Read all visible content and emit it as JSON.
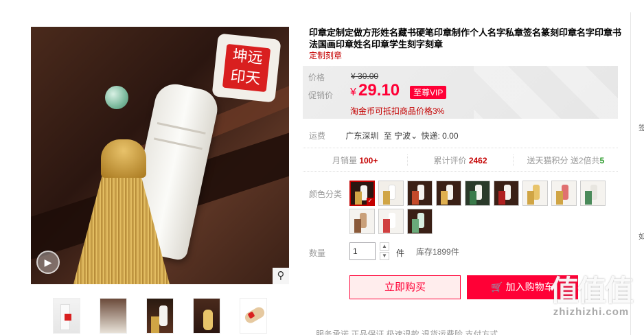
{
  "product": {
    "title": "印章定制定做方形姓名藏书硬笔印章制作个人名字私章签名篆刻印章名字印章书法国画印章姓名印章学生刻字刻章",
    "subtitle": "定制刻章"
  },
  "gallery": {
    "seal_text": "坤远印天",
    "thumbnails": [
      "thumb-1",
      "thumb-2",
      "thumb-3",
      "thumb-4",
      "thumb-5"
    ]
  },
  "price": {
    "orig_label": "价格",
    "orig_currency": "¥",
    "orig_value": "30.00",
    "sale_label": "促销价",
    "sale_currency": "¥",
    "sale_value": "29.10",
    "vip_badge": "至尊VIP",
    "coin_note": "淘金币可抵扣商品价格3%"
  },
  "shipping": {
    "label": "运费",
    "from": "广东深圳",
    "to_word": "至",
    "to": "宁波",
    "express": "快递: 0.00"
  },
  "stats": {
    "monthly_label": "月销量",
    "monthly_value": "100+",
    "reviews_label": "累计评价",
    "reviews_value": "2462",
    "points_label": "送天猫积分",
    "points_extra": "送2倍共",
    "points_value": "5"
  },
  "color": {
    "label": "颜色分类",
    "selected_index": 0
  },
  "quantity": {
    "label": "数量",
    "value": "1",
    "unit": "件",
    "stock": "库存1899件"
  },
  "actions": {
    "buy_now": "立即购买",
    "add_cart": "加入购物车"
  },
  "watermark": {
    "glyphs": "值值值",
    "url": "zhizhizhi.com"
  },
  "service_row": "服务承诺   正品保证   极速退款   退货运费险                  支付方式",
  "sidebar_chars": [
    "签",
    "如"
  ],
  "colors": {
    "accent": "#ff0036",
    "dark_red": "#c40000"
  }
}
